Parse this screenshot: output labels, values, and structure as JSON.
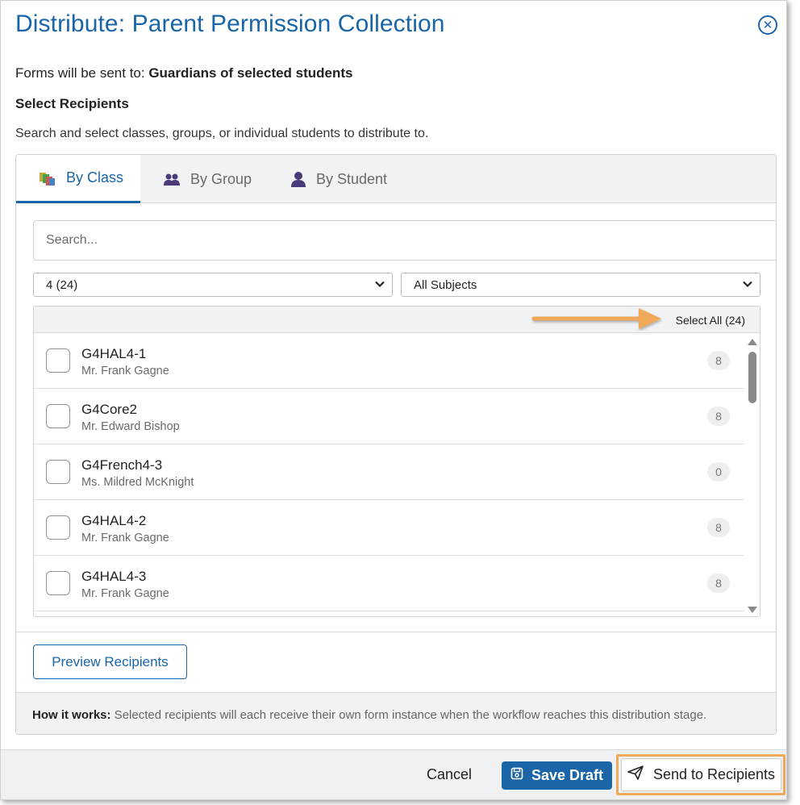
{
  "dialog": {
    "title": "Distribute: Parent Permission Collection",
    "sent_to_prefix": "Forms will be sent to: ",
    "sent_to_value": "Guardians of selected students",
    "section_title": "Select Recipients",
    "instructions": "Search and select classes, groups, or individual students to distribute to."
  },
  "tabs": [
    {
      "label": "By Class",
      "active": true,
      "icon": "class-icon"
    },
    {
      "label": "By Group",
      "active": false,
      "icon": "group-icon"
    },
    {
      "label": "By Student",
      "active": false,
      "icon": "student-icon"
    }
  ],
  "search": {
    "placeholder": "Search...",
    "value": ""
  },
  "filters": {
    "grade_selected": "4 (24)",
    "subject_selected": "All Subjects"
  },
  "list": {
    "select_all_label": "Select All (24)",
    "rows": [
      {
        "name": "G4HAL4-1",
        "teacher": "Mr. Frank Gagne",
        "count": "8"
      },
      {
        "name": "G4Core2",
        "teacher": "Mr. Edward Bishop",
        "count": "8"
      },
      {
        "name": "G4French4-3",
        "teacher": "Ms. Mildred McKnight",
        "count": "0"
      },
      {
        "name": "G4HAL4-2",
        "teacher": "Mr. Frank Gagne",
        "count": "8"
      },
      {
        "name": "G4HAL4-3",
        "teacher": "Mr. Frank Gagne",
        "count": "8"
      }
    ]
  },
  "preview_button": "Preview Recipients",
  "how_it_works": {
    "label": "How it works:",
    "text": " Selected recipients will each receive their own form instance when the workflow reaches this distribution stage."
  },
  "footer": {
    "cancel_label": "Cancel",
    "save_draft_label": "Save Draft",
    "send_label": "Send to Recipients"
  },
  "colors": {
    "primary": "#1a65a8",
    "highlight": "#f0a85a"
  }
}
